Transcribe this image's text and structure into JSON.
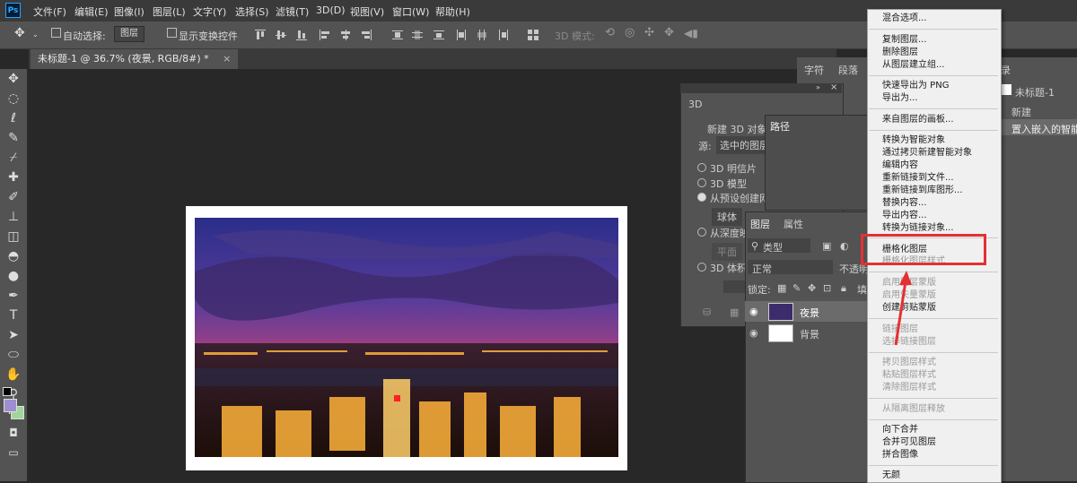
{
  "app": {
    "logo": "Ps"
  },
  "menubar": [
    "文件(F)",
    "编辑(E)",
    "图像(I)",
    "图层(L)",
    "文字(Y)",
    "选择(S)",
    "滤镜(T)",
    "3D(D)",
    "视图(V)",
    "窗口(W)",
    "帮助(H)"
  ],
  "options": {
    "auto_select_label": "自动选择:",
    "auto_select_value": "图层",
    "show_transform_label": "显示变换控件",
    "mode_3d_label": "3D 模式:"
  },
  "document": {
    "tab_title": "未标题-1 @ 36.7% (夜景, RGB/8#) *"
  },
  "panels": {
    "tab_char": "字符",
    "tab_para": "段落",
    "tab_history_partial": "录",
    "history_doc": "未标题-1",
    "history_new": "新建",
    "history_place": "置入嵌入的智能",
    "p3d_tab": "3D",
    "p3d_new_obj": "新建 3D 对象",
    "p3d_source_label": "源:",
    "p3d_source_value": "选中的图层",
    "p3d_postcard": "3D 明信片",
    "p3d_model": "3D 模型",
    "p3d_from_preset": "从预设创建网",
    "p3d_sphere": "球体",
    "p3d_depth": "从深度映",
    "p3d_plane": "平面",
    "p3d_volume": "3D 体积",
    "path_tab": "路径",
    "layers_tab": "图层",
    "props_tab": "属性",
    "filter_kind": "类型",
    "blend_mode": "正常",
    "opacity_label": "不透明",
    "lock_label": "锁定:",
    "fill_partial": "填",
    "layers": [
      {
        "name": "夜景"
      },
      {
        "name": "背景"
      }
    ]
  },
  "context_menu": {
    "items": [
      {
        "label": "混合选项...",
        "disabled": false
      },
      {
        "label": "复制图层...",
        "disabled": false
      },
      {
        "label": "删除图层",
        "disabled": false
      },
      {
        "label": "从图层建立组...",
        "disabled": false
      },
      {
        "label": "快速导出为 PNG",
        "disabled": false
      },
      {
        "label": "导出为...",
        "disabled": false
      },
      {
        "label": "来自图层的画板...",
        "disabled": false
      },
      {
        "label": "转换为智能对象",
        "disabled": false
      },
      {
        "label": "通过拷贝新建智能对象",
        "disabled": false
      },
      {
        "label": "编辑内容",
        "disabled": false
      },
      {
        "label": "重新链接到文件...",
        "disabled": false
      },
      {
        "label": "重新链接到库图形...",
        "disabled": false
      },
      {
        "label": "替换内容...",
        "disabled": false
      },
      {
        "label": "导出内容...",
        "disabled": false
      },
      {
        "label": "转换为链接对象...",
        "disabled": false
      },
      {
        "label": "栅格化图层",
        "disabled": false
      },
      {
        "label": "栅格化图层样式",
        "disabled": true
      },
      {
        "label": "启用图层蒙版",
        "disabled": true
      },
      {
        "label": "启用矢量蒙版",
        "disabled": true
      },
      {
        "label": "创建剪贴蒙版",
        "disabled": false
      },
      {
        "label": "链接图层",
        "disabled": true
      },
      {
        "label": "选择链接图层",
        "disabled": true
      },
      {
        "label": "拷贝图层样式",
        "disabled": true
      },
      {
        "label": "粘贴图层样式",
        "disabled": true
      },
      {
        "label": "清除图层样式",
        "disabled": true
      },
      {
        "label": "从隔离图层释放",
        "disabled": true
      },
      {
        "label": "向下合并",
        "disabled": false
      },
      {
        "label": "合并可见图层",
        "disabled": false
      },
      {
        "label": "拼合图像",
        "disabled": false
      },
      {
        "label": "无颜",
        "disabled": false
      }
    ]
  },
  "colors": {
    "highlight": "#e53033",
    "accent_ps": "#31a8ff",
    "foreground_swatch": "#9d8fcf",
    "background_swatch": "#9fd79a"
  }
}
